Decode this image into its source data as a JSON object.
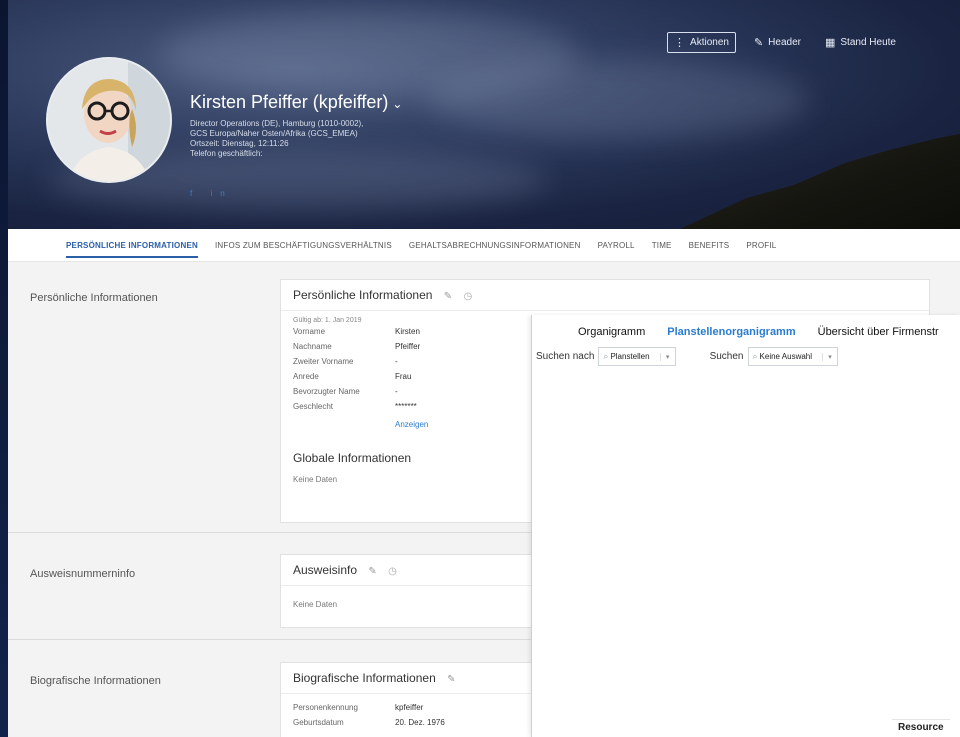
{
  "header": {
    "actions_label": "Aktionen",
    "header_label": "Header",
    "stand_label": "Stand Heute",
    "name": "Kirsten Pfeiffer (kpfeiffer)",
    "meta_line1": "Director Operations (DE), Hamburg (1010-0002),",
    "meta_line2": "GCS Europa/Naher Osten/Afrika (GCS_EMEA)",
    "meta_line3": "Ortszeit: Dienstag, 12:11:26",
    "phone_label": "Telefon geschäftlich:",
    "social": "f  in"
  },
  "tabs": [
    "PERSÖNLICHE INFORMATIONEN",
    "INFOS ZUM BESCHÄFTIGUNGSVERHÄLTNIS",
    "GEHALTSABRECHNUNGSINFORMATIONEN",
    "PAYROLL",
    "TIME",
    "BENEFITS",
    "PROFIL"
  ],
  "sections": {
    "personal": {
      "label": "Persönliche Informationen",
      "card_title": "Persönliche Informationen",
      "effective": "Gültig ab: 1. Jan 2019",
      "fields": [
        {
          "k": "Vorname",
          "v": "Kirsten"
        },
        {
          "k": "Nachname",
          "v": "Pfeiffer"
        },
        {
          "k": "Zweiter Vorname",
          "v": "-"
        },
        {
          "k": "Anrede",
          "v": "Frau"
        },
        {
          "k": "Bevorzugter Name",
          "v": "-"
        },
        {
          "k": "Geschlecht",
          "v": "*******"
        }
      ],
      "show_link": "Anzeigen",
      "global_title": "Globale Informationen",
      "global_nodata": "Keine Daten"
    },
    "id": {
      "label": "Ausweisnummerninfo",
      "card_title": "Ausweisinfo",
      "nodata": "Keine Daten"
    },
    "bio": {
      "label": "Biografische Informationen",
      "card_title": "Biografische Informationen",
      "fields": [
        {
          "k": "Personenkennung",
          "v": "kpfeiffer"
        },
        {
          "k": "Geburtsdatum",
          "v": "20. Dez. 1976"
        }
      ]
    }
  },
  "overlay": {
    "tabs": [
      "Organigramm",
      "Planstellenorganigramm",
      "Übersicht über Firmenstr"
    ],
    "search_by_label": "Suchen nach",
    "search_by_value": "Planstellen",
    "search_label": "Suchen",
    "search_value": "Keine Auswahl",
    "resource": "Resource"
  }
}
